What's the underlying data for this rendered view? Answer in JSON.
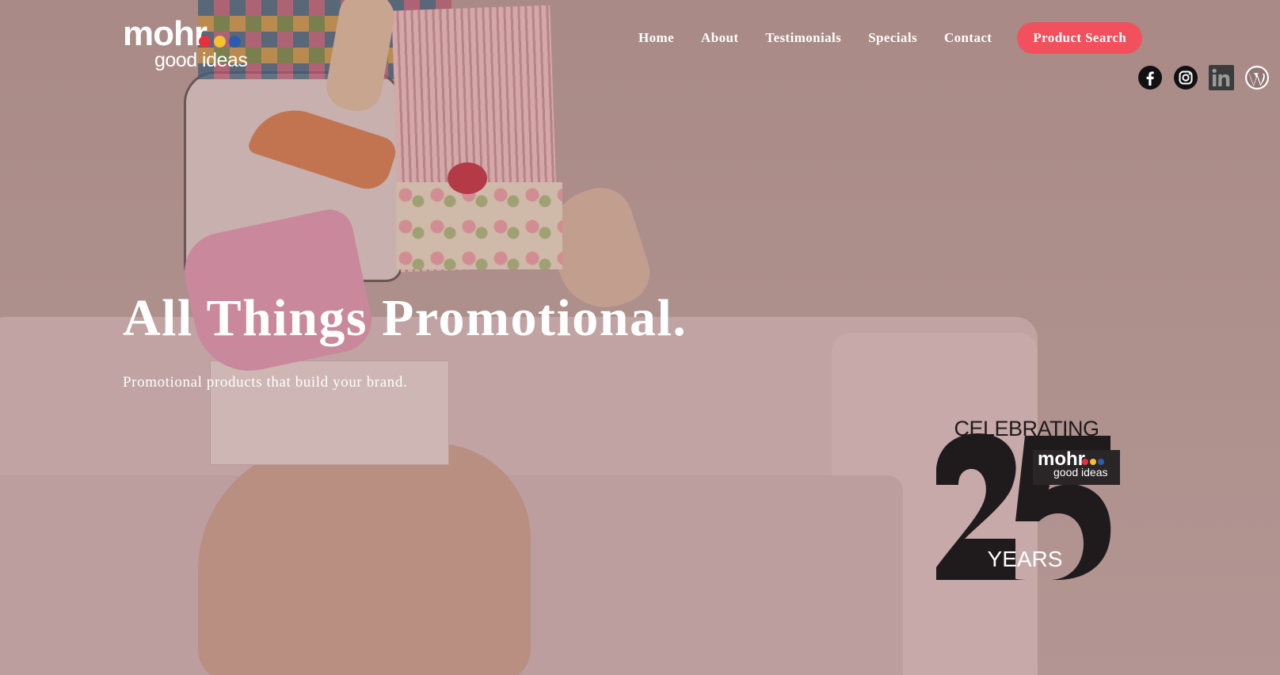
{
  "brand": {
    "logo_text": "mohr",
    "logo_sub": "good ideas",
    "dot_colors": [
      "#e8303c",
      "#f2c230",
      "#2a5db0"
    ]
  },
  "nav": {
    "items": [
      {
        "label": "Home"
      },
      {
        "label": "About"
      },
      {
        "label": "Testimonials"
      },
      {
        "label": "Specials"
      },
      {
        "label": "Contact"
      }
    ],
    "cta_label": "Product Search",
    "cta_color": "#f2505c"
  },
  "socials": [
    {
      "icon": "facebook-icon"
    },
    {
      "icon": "instagram-icon"
    },
    {
      "icon": "linkedin-icon"
    },
    {
      "icon": "wordpress-icon"
    }
  ],
  "hero": {
    "title": "All Things Promotional.",
    "subtitle": "Promotional products that build your brand."
  },
  "badge": {
    "top_text": "CELEBRATING",
    "number": "25",
    "bottom_text": "YEARS",
    "logo_text": "mohr",
    "logo_sub": "good ideas"
  }
}
